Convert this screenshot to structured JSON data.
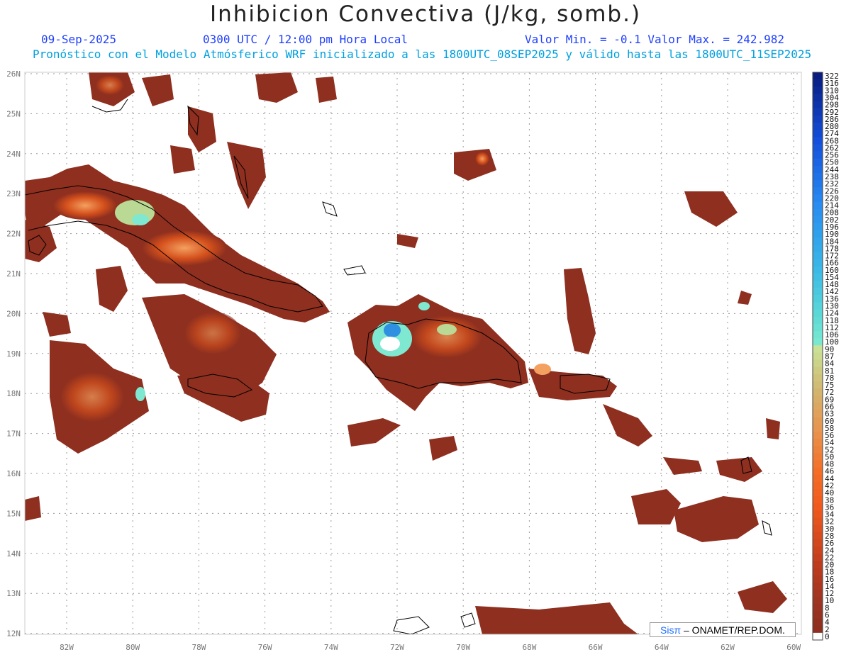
{
  "header": {
    "title": "Inhibicion Convectiva (J/kg, somb.)",
    "date": "09-Sep-2025",
    "time": "0300 UTC / 12:00 pm Hora Local",
    "minmax": "Valor Min. = -0.1  Valor Max. = 242.982",
    "forecast": "Pronóstico con el Modelo Atmósferico WRF inicializado a las 1800UTC_08SEP2025 y válido hasta las  1800UTC_11SEP2025"
  },
  "axes": {
    "longitude_labels": [
      "82W",
      "80W",
      "78W",
      "76W",
      "74W",
      "72W",
      "70W",
      "68W",
      "66W",
      "64W",
      "62W",
      "60W"
    ],
    "latitude_labels": [
      "26N",
      "25N",
      "24N",
      "23N",
      "22N",
      "21N",
      "20N",
      "19N",
      "18N",
      "17N",
      "16N",
      "15N",
      "14N",
      "13N",
      "12N"
    ]
  },
  "colorbar": {
    "labels": [
      "322",
      "316",
      "310",
      "304",
      "298",
      "292",
      "286",
      "280",
      "274",
      "268",
      "262",
      "256",
      "250",
      "244",
      "238",
      "232",
      "226",
      "220",
      "214",
      "208",
      "202",
      "196",
      "190",
      "184",
      "178",
      "172",
      "166",
      "160",
      "154",
      "148",
      "142",
      "136",
      "130",
      "124",
      "118",
      "112",
      "106",
      "100",
      "90",
      "87",
      "84",
      "81",
      "78",
      "75",
      "72",
      "69",
      "66",
      "63",
      "60",
      "58",
      "56",
      "54",
      "52",
      "50",
      "48",
      "46",
      "44",
      "42",
      "40",
      "38",
      "36",
      "34",
      "32",
      "30",
      "28",
      "26",
      "24",
      "22",
      "20",
      "18",
      "16",
      "14",
      "12",
      "10",
      "8",
      "6",
      "4",
      "2",
      "0"
    ]
  },
  "credit": {
    "brand": "Sisπ",
    "text": " – ONAMET/REP.DOM."
  },
  "colors": {
    "land_fill": "#8e2f1f",
    "warm": "#e86a1c",
    "cool": "#7fe8d0",
    "coast": "#000000"
  }
}
